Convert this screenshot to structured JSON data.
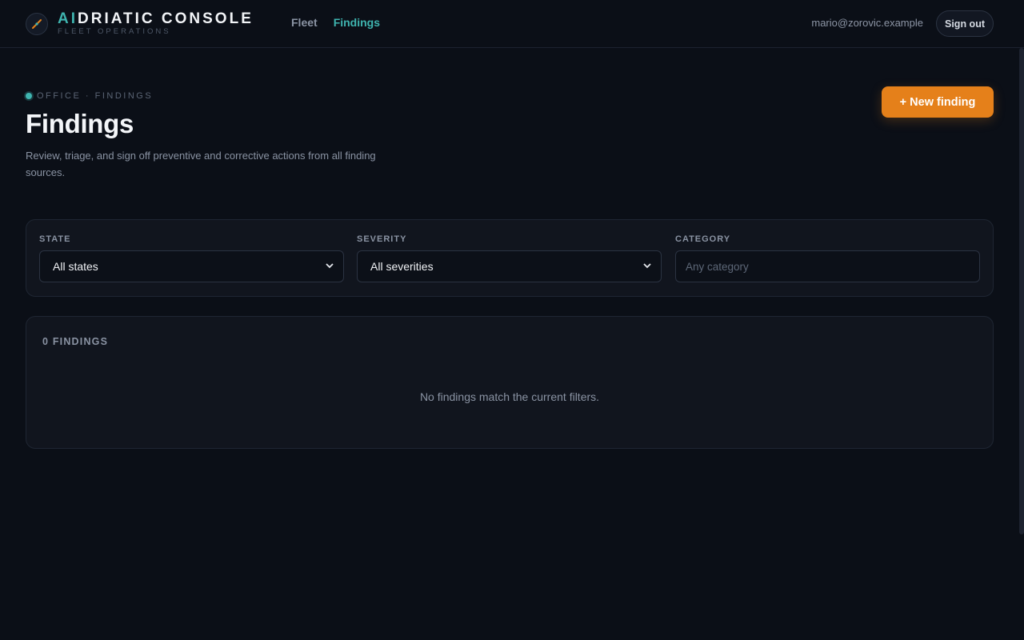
{
  "header": {
    "brand_prefix": "AI",
    "brand_rest": "DRIATIC CONSOLE",
    "brand_sub": "FLEET OPERATIONS",
    "nav": [
      {
        "label": "Fleet",
        "active": false
      },
      {
        "label": "Findings",
        "active": true
      }
    ],
    "user_email": "mario@zorovic.example",
    "signout_label": "Sign out"
  },
  "page": {
    "breadcrumb": "OFFICE · FINDINGS",
    "title": "Findings",
    "description": "Review, triage, and sign off preventive and corrective actions from all finding sources.",
    "new_button_label": "+ New finding"
  },
  "filters": {
    "state": {
      "label": "STATE",
      "value": "All states"
    },
    "severity": {
      "label": "SEVERITY",
      "value": "All severities"
    },
    "category": {
      "label": "CATEGORY",
      "placeholder": "Any category",
      "value": ""
    }
  },
  "results": {
    "count_label": "0 FINDINGS",
    "empty_message": "No findings match the current filters."
  },
  "colors": {
    "accent": "#3fb5b0",
    "primary_button": "#e5801a",
    "background": "#0b0f17"
  },
  "icons": {
    "logo": "compass-needle-icon",
    "select_chevron": "chevron-down-icon"
  }
}
